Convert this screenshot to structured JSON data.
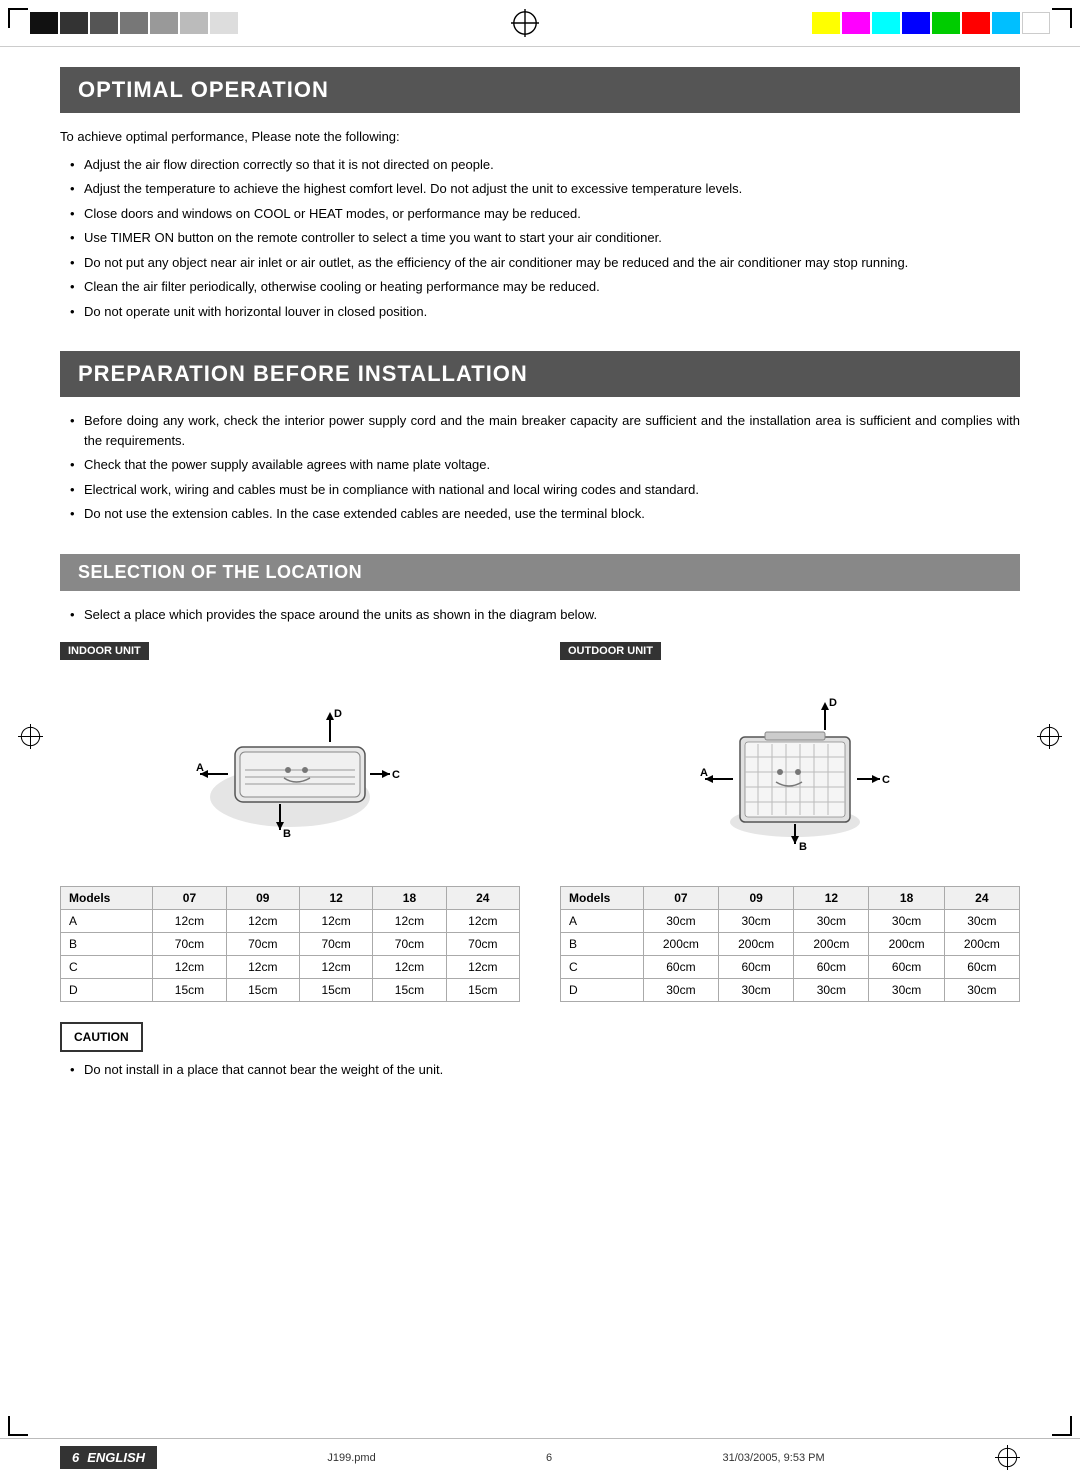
{
  "colorBars": {
    "left": [
      "#111",
      "#333",
      "#555",
      "#777",
      "#999",
      "#bbb",
      "#ddd"
    ],
    "right": [
      "#ffff00",
      "#ff00ff",
      "#00ffff",
      "#0000ff",
      "#00ff00",
      "#ff0000",
      "#00bfff",
      "#ffffff"
    ]
  },
  "sections": {
    "optimalOperation": {
      "title": "OPTIMAL OPERATION",
      "intro": "To achieve optimal performance, Please note the following:",
      "bullets": [
        "Adjust the air flow direction correctly so that it is not directed on people.",
        "Adjust the temperature to achieve the highest comfort level. Do not adjust the unit to excessive temperature levels.",
        "Close doors and windows on COOL or HEAT modes, or performance may be reduced.",
        "Use TIMER ON button on the remote controller to select a time you want to start your air conditioner.",
        "Do not put any object near air inlet or air outlet, as the efficiency of the air conditioner may be reduced and the air conditioner may stop running.",
        "Clean the air filter periodically, otherwise cooling or heating performance may be reduced.",
        "Do not operate unit with horizontal louver in closed position."
      ]
    },
    "preparationBeforeInstallation": {
      "title": "PREPARATION BEFORE INSTALLATION",
      "bullets": [
        "Before doing any work, check the interior power supply cord and the main breaker capacity are sufficient and the installation area is sufficient and complies with the requirements.",
        "Check that the power supply available agrees with name plate voltage.",
        "Electrical work, wiring and cables must be in compliance with national and local wiring codes and standard.",
        "Do not use the extension cables. In the case extended cables are needed, use the terminal block."
      ]
    },
    "selectionOfLocation": {
      "title": "SELECTION OF THE LOCATION",
      "intro": "Select a place which provides the space around the units as shown in the diagram below.",
      "indoorUnit": {
        "label": "INDOOR UNIT",
        "table": {
          "headers": [
            "Models",
            "07",
            "09",
            "12",
            "18",
            "24"
          ],
          "rows": [
            [
              "A",
              "12cm",
              "12cm",
              "12cm",
              "12cm",
              "12cm"
            ],
            [
              "B",
              "70cm",
              "70cm",
              "70cm",
              "70cm",
              "70cm"
            ],
            [
              "C",
              "12cm",
              "12cm",
              "12cm",
              "12cm",
              "12cm"
            ],
            [
              "D",
              "15cm",
              "15cm",
              "15cm",
              "15cm",
              "15cm"
            ]
          ]
        }
      },
      "outdoorUnit": {
        "label": "OUTDOOR UNIT",
        "table": {
          "headers": [
            "Models",
            "07",
            "09",
            "12",
            "18",
            "24"
          ],
          "rows": [
            [
              "A",
              "30cm",
              "30cm",
              "30cm",
              "30cm",
              "30cm"
            ],
            [
              "B",
              "200cm",
              "200cm",
              "200cm",
              "200cm",
              "200cm"
            ],
            [
              "C",
              "60cm",
              "60cm",
              "60cm",
              "60cm",
              "60cm"
            ],
            [
              "D",
              "30cm",
              "30cm",
              "30cm",
              "30cm",
              "30cm"
            ]
          ]
        }
      }
    },
    "caution": {
      "label": "CAUTION",
      "bullets": [
        "Do not install in a place that cannot bear the weight of the unit."
      ]
    }
  },
  "footer": {
    "pageNumber": "6",
    "englishLabel": "ENGLISH",
    "leftText": "J199.pmd",
    "centerText": "6",
    "rightText": "31/03/2005, 9:53 PM"
  }
}
